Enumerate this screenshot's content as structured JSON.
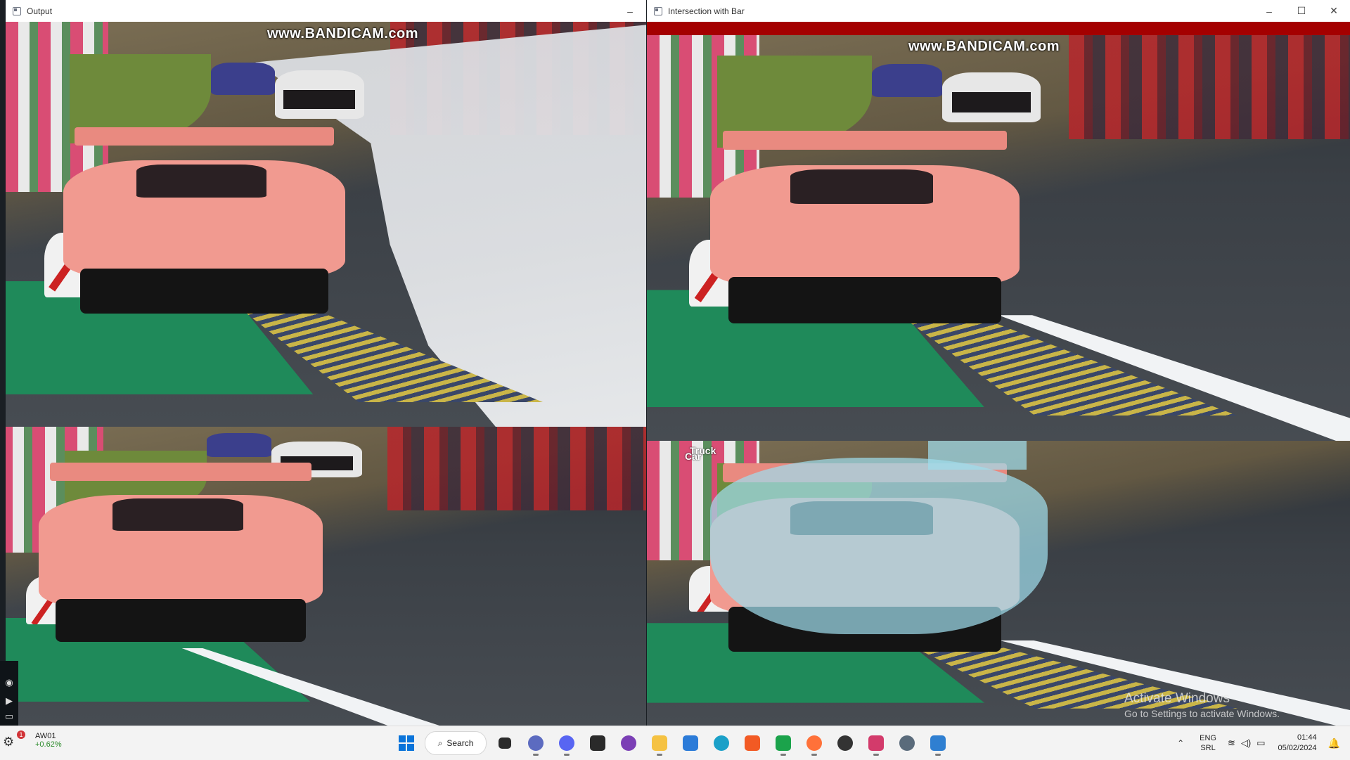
{
  "windows": {
    "output": {
      "title": "Output",
      "minimize_glyph": "–"
    },
    "intersection": {
      "title": "Intersection with Bar",
      "minimize_glyph": "–",
      "maximize_glyph": "☐",
      "close_glyph": "✕"
    }
  },
  "watermark": "www.BANDICAM.com",
  "detections": {
    "label_truck": "Truck",
    "label_car": "Car"
  },
  "activation": {
    "title": "Activate Windows",
    "subtitle": "Go to Settings to activate Windows."
  },
  "widget": {
    "badge": "1",
    "symbol": "AW01",
    "change": "+0.62%"
  },
  "taskbar": {
    "search_label": "Search",
    "apps": [
      {
        "name": "task-view",
        "color": "#2b2b2b"
      },
      {
        "name": "zoom",
        "color": "#5c6bc0"
      },
      {
        "name": "discord",
        "color": "#5865f2"
      },
      {
        "name": "media-app",
        "color": "#2a2a2a"
      },
      {
        "name": "github-desktop",
        "color": "#7b3fb5"
      },
      {
        "name": "file-explorer",
        "color": "#f5c242"
      },
      {
        "name": "microsoft-store",
        "color": "#2b7bd8"
      },
      {
        "name": "edge",
        "color": "#1aa0c8"
      },
      {
        "name": "brave",
        "color": "#f25a24"
      },
      {
        "name": "pycharm",
        "color": "#1ba34b"
      },
      {
        "name": "firefox",
        "color": "#ff7139"
      },
      {
        "name": "media-player",
        "color": "#333333"
      },
      {
        "name": "snipping-tool",
        "color": "#d33b6b"
      },
      {
        "name": "settings",
        "color": "#5a6b7b"
      },
      {
        "name": "remote-app",
        "color": "#2f7fd1"
      }
    ],
    "tray": {
      "lang_top": "ENG",
      "lang_bottom": "SRL",
      "time": "01:44",
      "date": "05/02/2024"
    }
  }
}
